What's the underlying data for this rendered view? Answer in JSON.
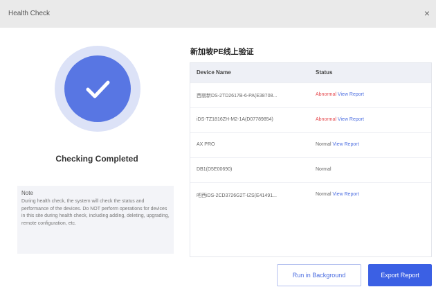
{
  "window": {
    "title": "Health Check",
    "close_label": "×"
  },
  "status": {
    "label": "Checking Completed"
  },
  "note": {
    "title": "Note",
    "text": "During health check, the system will check the status and performance of the devices. Do NOT perform operations for devices in this site during health check, including adding, deleting, upgrading, remote configuration, etc."
  },
  "site": {
    "heading": "新加坡PE线上验证"
  },
  "table": {
    "headers": {
      "device": "Device Name",
      "status": "Status"
    },
    "rows": [
      {
        "device": "西丽新DS-2TD2617B-6-PA(E38708...",
        "status": "Abnormal",
        "status_color": "#e5484d",
        "link": "View Report"
      },
      {
        "device": "iDS-TZ1816ZH-M2-1A(D07789854)",
        "status": "Abnormal",
        "status_color": "#e5484d",
        "link": "View Report"
      },
      {
        "device": "AX PRO",
        "status": "Normal",
        "status_color": "#666666",
        "link": "View Report"
      },
      {
        "device": "DB1(D5E00690)",
        "status": "Normal",
        "status_color": "#666666",
        "link": ""
      },
      {
        "device": "吧西iDS-2CD3726G2T-IZS(E41491...",
        "status": "Normal",
        "status_color": "#666666",
        "link": "View Report"
      }
    ]
  },
  "buttons": {
    "background": "Run in Background",
    "export": "Export Report"
  },
  "colors": {
    "accent": "#3b60e4",
    "abnormal": "#e5484d",
    "link": "#4a6ce0",
    "ring": "#5876e3"
  },
  "icons": {
    "status": "check-icon",
    "close": "close-icon"
  }
}
